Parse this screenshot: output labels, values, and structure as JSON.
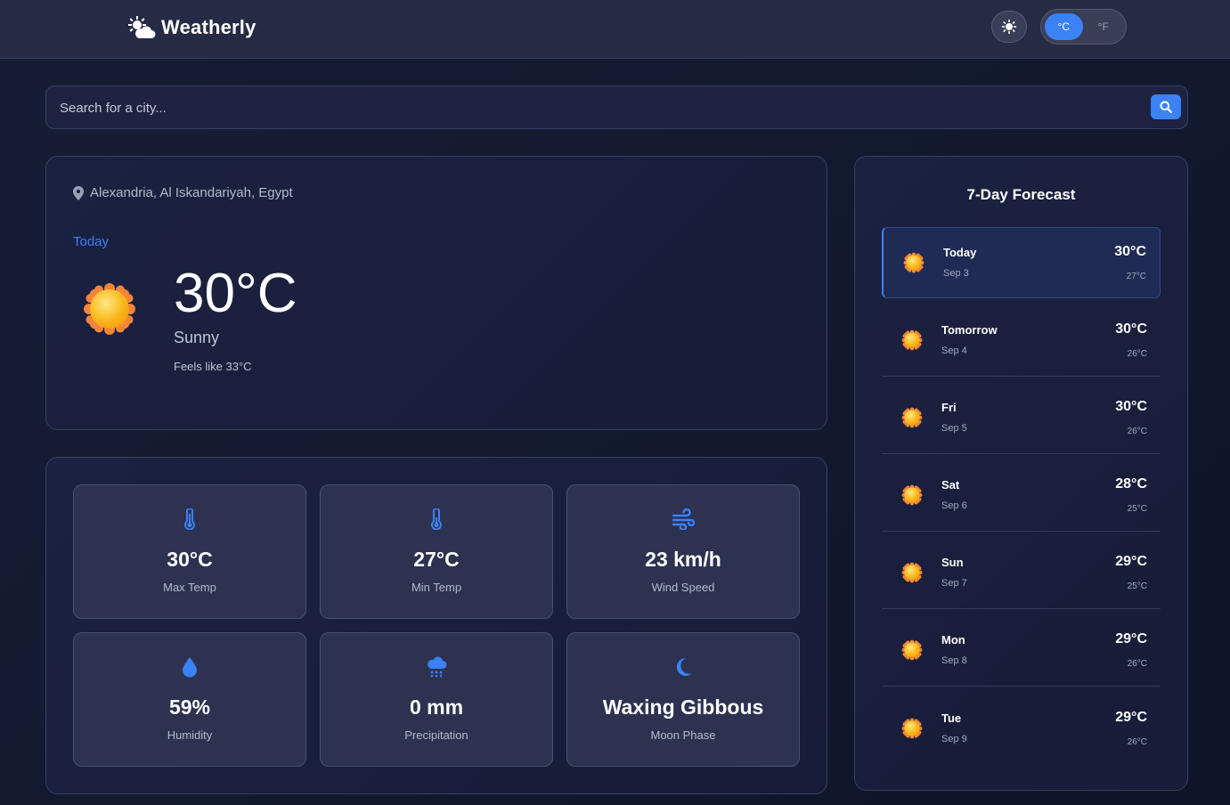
{
  "header": {
    "brand": "Weatherly",
    "unit_c": "°C",
    "unit_f": "°F",
    "active_unit": "C"
  },
  "search": {
    "placeholder": "Search for a city..."
  },
  "current": {
    "location": "Alexandria, Al Iskandariyah, Egypt",
    "day_label": "Today",
    "temp": "30°C",
    "condition": "Sunny",
    "feels_like": "Feels like 33°C"
  },
  "stats": [
    {
      "icon": "thermometer-icon",
      "value": "30°C",
      "label": "Max Temp"
    },
    {
      "icon": "thermometer-icon",
      "value": "27°C",
      "label": "Min Temp"
    },
    {
      "icon": "wind-icon",
      "value": "23 km/h",
      "label": "Wind Speed"
    },
    {
      "icon": "droplet-icon",
      "value": "59%",
      "label": "Humidity"
    },
    {
      "icon": "cloud-rain-icon",
      "value": "0 mm",
      "label": "Precipitation"
    },
    {
      "icon": "moon-icon",
      "value": "Waxing Gibbous",
      "label": "Moon Phase"
    }
  ],
  "forecast": {
    "title": "7-Day Forecast",
    "days": [
      {
        "name": "Today",
        "date": "Sep 3",
        "max": "30°C",
        "min": "27°C"
      },
      {
        "name": "Tomorrow",
        "date": "Sep 4",
        "max": "30°C",
        "min": "26°C"
      },
      {
        "name": "Fri",
        "date": "Sep 5",
        "max": "30°C",
        "min": "26°C"
      },
      {
        "name": "Sat",
        "date": "Sep 6",
        "max": "28°C",
        "min": "25°C"
      },
      {
        "name": "Sun",
        "date": "Sep 7",
        "max": "29°C",
        "min": "25°C"
      },
      {
        "name": "Mon",
        "date": "Sep 8",
        "max": "29°C",
        "min": "26°C"
      },
      {
        "name": "Tue",
        "date": "Sep 9",
        "max": "29°C",
        "min": "26°C"
      }
    ]
  },
  "colors": {
    "accent": "#3b82f6",
    "sun_core": "#fbbf24",
    "sun_rays": "#f97316"
  }
}
